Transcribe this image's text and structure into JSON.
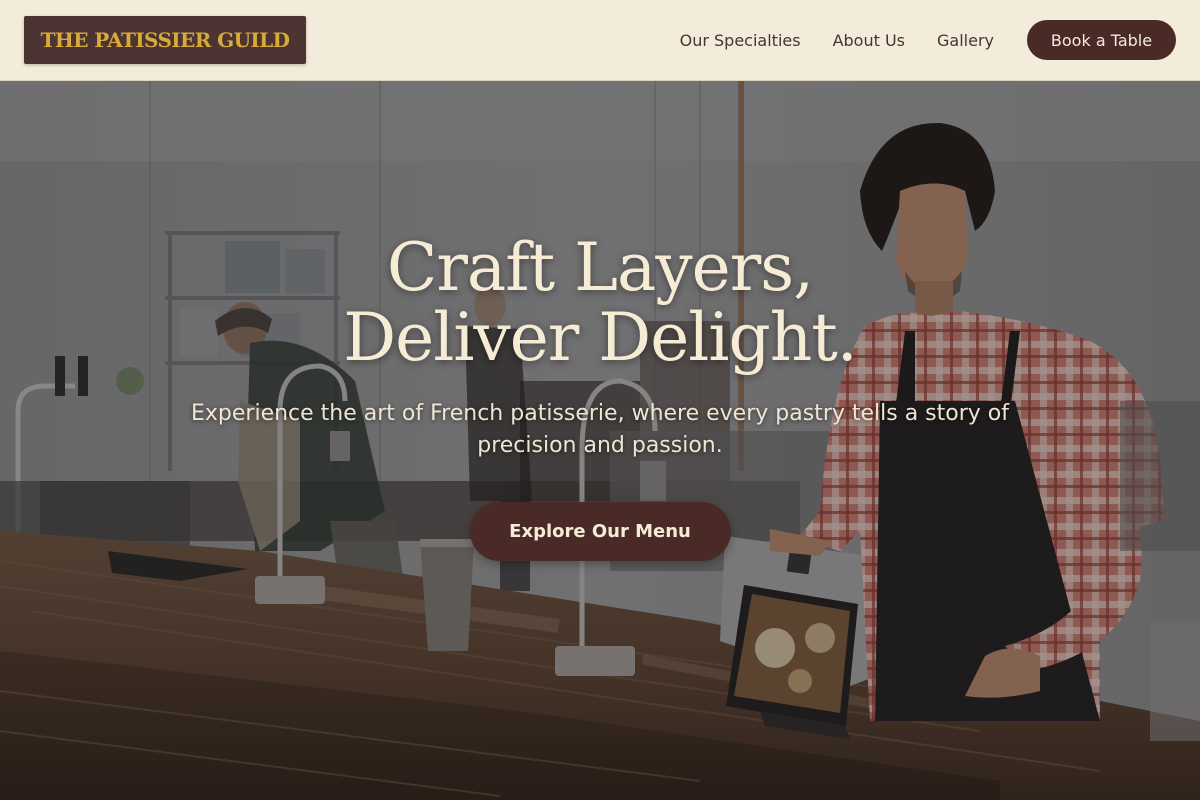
{
  "header": {
    "logo_text": "THE PATISSIER GUILD",
    "nav": [
      {
        "label": "Our Specialties"
      },
      {
        "label": "About Us"
      },
      {
        "label": "Gallery"
      }
    ],
    "cta_label": "Book a Table"
  },
  "hero": {
    "title_line_1": "Craft Layers,",
    "title_line_2": "Deliver Delight.",
    "subtitle": "Experience the art of French patisserie, where every pastry tells a story of precision and passion.",
    "button_label": "Explore Our Menu"
  },
  "colors": {
    "header_bg": "#f4ecda",
    "brand_dark": "#4a2a27",
    "logo_gold": "#d9a93a",
    "hero_text": "#f6ecd6"
  }
}
